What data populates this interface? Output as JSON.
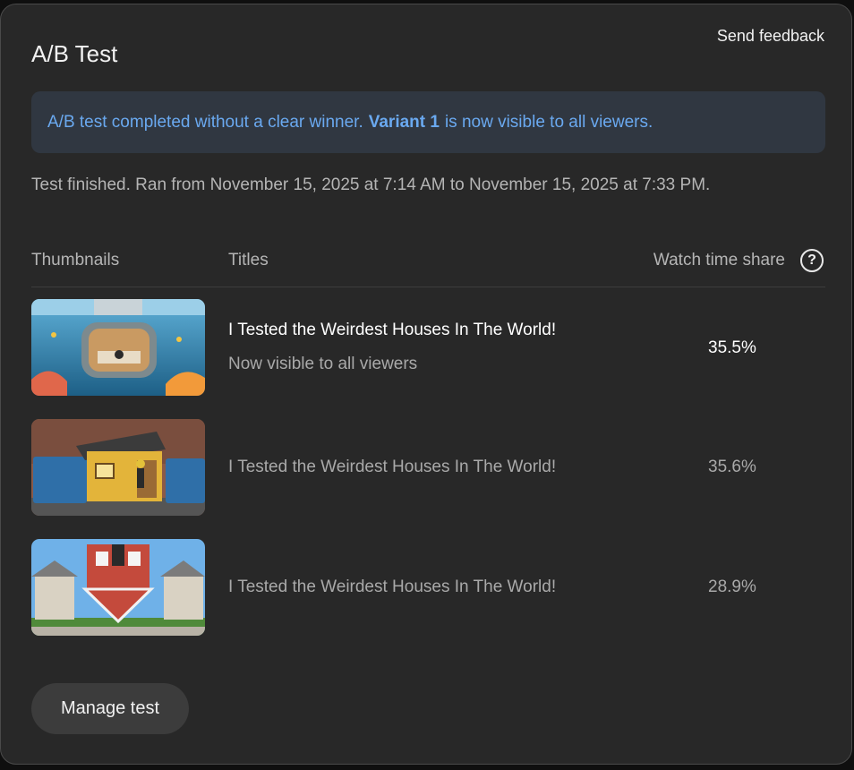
{
  "header": {
    "title": "A/B Test",
    "feedback_label": "Send feedback"
  },
  "banner": {
    "text_before": "A/B test completed without a clear winner.",
    "winner": "Variant 1",
    "text_after": "is now visible to all viewers.",
    "color": "#6aa9f0"
  },
  "status": "Test finished. Ran from November 15, 2025 at 7:14 AM to November 15, 2025 at 7:33 PM.",
  "table": {
    "columns": {
      "thumbnails": "Thumbnails",
      "titles": "Titles",
      "watch_time": "Watch time share"
    },
    "help_icon": "help-circle-icon",
    "rows": [
      {
        "thumbnail": "underwater-bedroom",
        "title": "I Tested the Weirdest Houses In The World!",
        "subtitle": "Now visible to all viewers",
        "share": "35.5%"
      },
      {
        "thumbnail": "dumpster-house",
        "title": "I Tested the Weirdest Houses In The World!",
        "share": "35.6%"
      },
      {
        "thumbnail": "upside-down-house",
        "title": "I Tested the Weirdest Houses In The World!",
        "share": "28.9%"
      }
    ]
  },
  "manage_button": "Manage test"
}
